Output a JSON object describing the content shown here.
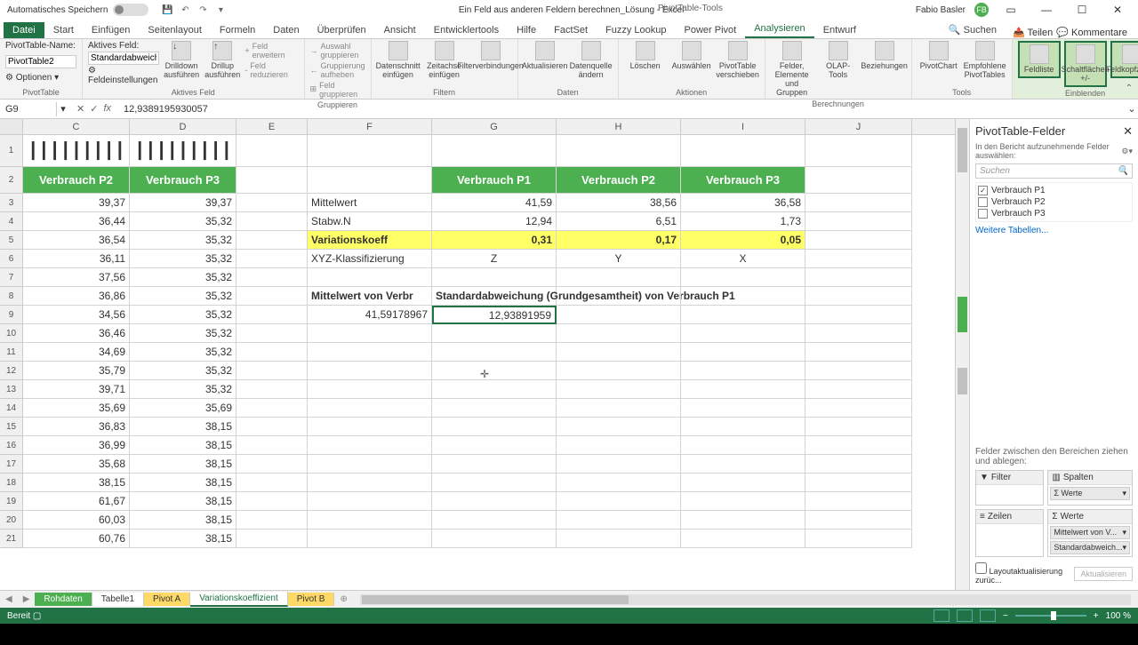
{
  "title": {
    "autosave": "Automatisches Speichern",
    "doc": "Ein Feld aus anderen Feldern berechnen_Lösung - Excel",
    "tool": "PivotTable-Tools",
    "user": "Fabio Basler",
    "badge": "FB"
  },
  "tabs": {
    "datei": "Datei",
    "items": [
      "Start",
      "Einfügen",
      "Seitenlayout",
      "Formeln",
      "Daten",
      "Überprüfen",
      "Ansicht",
      "Entwicklertools",
      "Hilfe",
      "FactSet",
      "Fuzzy Lookup",
      "Power Pivot"
    ],
    "active": "Analysieren",
    "after": [
      "Entwurf"
    ],
    "search": "Suchen",
    "share": "Teilen",
    "comments": "Kommentare"
  },
  "ribbon": {
    "pvname_label": "PivotTable-Name:",
    "pvname": "PivotTable2",
    "options": "Optionen",
    "activefield_label": "Aktives Feld:",
    "activefield": "Standardabweich",
    "fieldsettings": "Feldeinstellungen",
    "drill1": "Drilldown ausführen",
    "drill2": "Drillup ausführen",
    "expand": "Feld erweitern",
    "reduce": "Feld reduzieren",
    "grp1": "Auswahl gruppieren",
    "grp2": "Gruppierung aufheben",
    "grp3": "Feld gruppieren",
    "slicer": "Datenschnitt einfügen",
    "timeline": "Zeitachse einfügen",
    "filterconn": "Filterverbindungen",
    "refresh": "Aktualisieren",
    "changesrc": "Datenquelle ändern",
    "clear": "Löschen",
    "select": "Auswählen",
    "move": "PivotTable verschieben",
    "fields": "Felder, Elemente und Gruppen",
    "olap": "OLAP-Tools",
    "rels": "Beziehungen",
    "chart": "PivotChart",
    "recommended": "Empfohlene PivotTables",
    "fieldlist": "Feldliste",
    "buttons": "Schaltflächen +/-",
    "headers": "Feldkopfzeilen",
    "groups": {
      "g1": "PivotTable",
      "g2": "Aktives Feld",
      "g3": "Gruppieren",
      "g4": "Filtern",
      "g5": "Daten",
      "g6": "Aktionen",
      "g7": "Berechnungen",
      "g8": "Tools",
      "g9": "Einblenden"
    }
  },
  "namebox": "G9",
  "formula": "12,9389195930057",
  "cols": [
    "C",
    "D",
    "E",
    "F",
    "G",
    "H",
    "I",
    "J"
  ],
  "headers": {
    "p2": "Verbrauch P2",
    "p3": "Verbrauch P3",
    "p1": "Verbrauch P1"
  },
  "stats": {
    "r3": {
      "l": "Mittelwert",
      "g": "41,59",
      "h": "38,56",
      "i": "36,58"
    },
    "r4": {
      "l": "Stabw.N",
      "g": "12,94",
      "h": "6,51",
      "i": "1,73"
    },
    "r5": {
      "l": "Variationskoeff",
      "g": "0,31",
      "h": "0,17",
      "i": "0,05"
    },
    "r6": {
      "l": "XYZ-Klassifizierung",
      "g": "Z",
      "h": "Y",
      "i": "X"
    }
  },
  "pivot": {
    "h1": "Mittelwert von Verbr",
    "h2": "Standardabweichung (Grundgesamtheit) von Verbrauch P1",
    "v1": "41,59178967",
    "v2": "12,93891959"
  },
  "colC": [
    "39,37",
    "36,44",
    "36,54",
    "36,11",
    "37,56",
    "36,86",
    "34,56",
    "36,46",
    "34,69",
    "35,79",
    "39,71",
    "35,69",
    "36,83",
    "36,99",
    "35,68",
    "38,15",
    "61,67",
    "60,03",
    "60,76"
  ],
  "colD": [
    "39,37",
    "35,32",
    "35,32",
    "35,32",
    "35,32",
    "35,32",
    "35,32",
    "35,32",
    "35,32",
    "35,32",
    "35,32",
    "35,69",
    "38,15",
    "38,15",
    "38,15",
    "38,15",
    "38,15",
    "38,15",
    "38,15"
  ],
  "sheets": {
    "s1": "Rohdaten",
    "s2": "Tabelle1",
    "s3": "Pivot A",
    "s4": "Variationskoeffizient",
    "s5": "Pivot B"
  },
  "pane": {
    "title": "PivotTable-Felder",
    "hint": "In den Bericht aufzunehmende Felder auswählen:",
    "search": "Suchen",
    "f1": "Verbrauch P1",
    "f2": "Verbrauch P2",
    "f3": "Verbrauch P3",
    "more": "Weitere Tabellen...",
    "drag": "Felder zwischen den Bereichen ziehen und ablegen:",
    "filter": "Filter",
    "cols": "Spalten",
    "rows": "Zeilen",
    "vals": "Werte",
    "werte": "Werte",
    "v1": "Mittelwert von V...",
    "v2": "Standardabweich...",
    "layout": "Layoutaktualisierung zurüc...",
    "update": "Aktualisieren"
  },
  "status": {
    "ready": "Bereit",
    "zoom": "100 %"
  }
}
